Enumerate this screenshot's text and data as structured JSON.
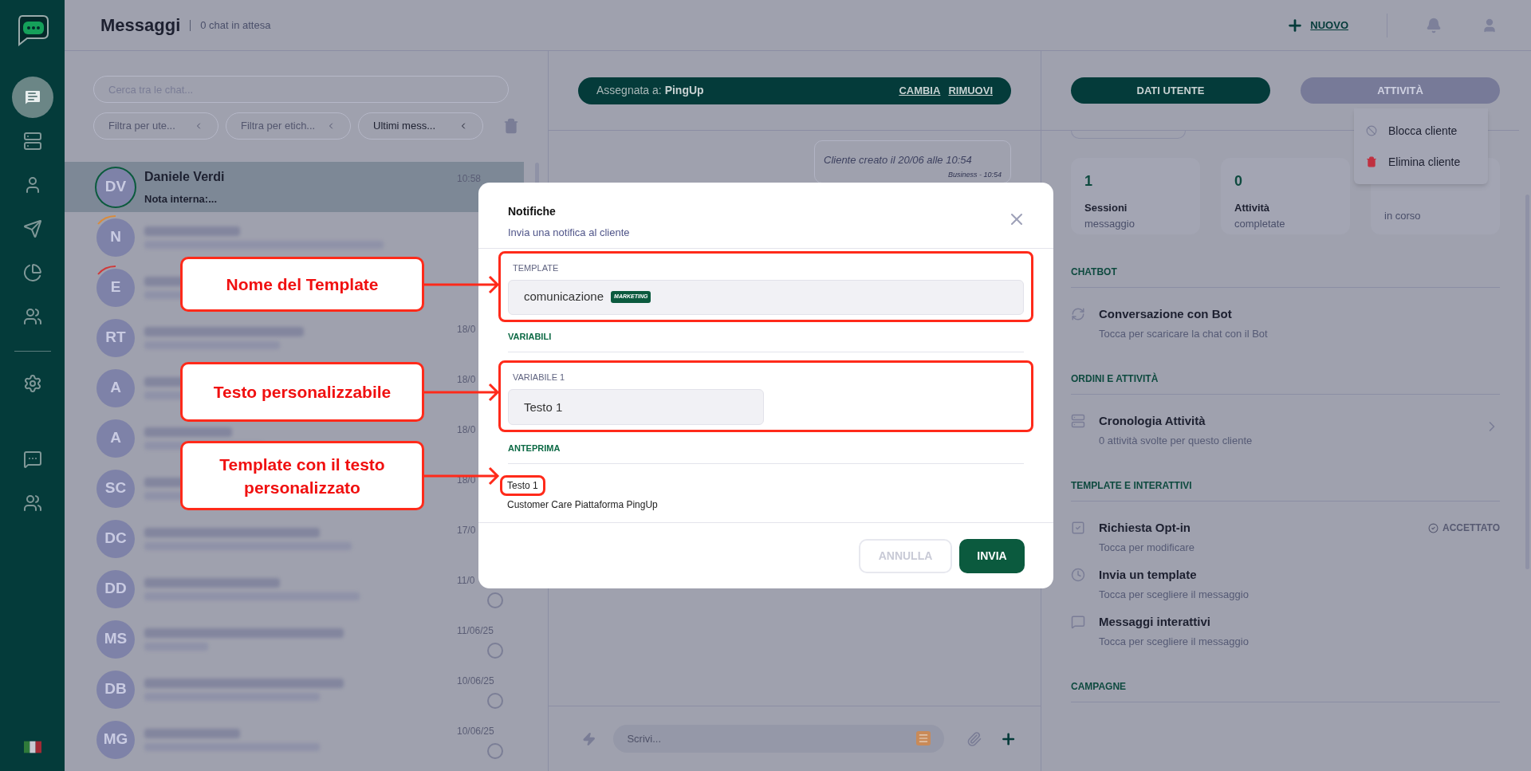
{
  "nav": [
    {
      "selected": true
    },
    {
      "selected": false
    },
    {
      "selected": false
    },
    {
      "selected": false
    },
    {
      "selected": false
    },
    {
      "selected": false
    },
    {
      "selected": false
    },
    {
      "selected": false
    },
    {
      "selected": false
    }
  ],
  "header": {
    "title": "Messaggi",
    "subtitle": "0 chat in attesa",
    "new_button": "NUOVO"
  },
  "chat_list": {
    "search": {
      "placeholder": "Cerca tra le chat..."
    },
    "filters": [
      {
        "label": "Filtra per ute...",
        "active": false
      },
      {
        "label": "Filtra per etich...",
        "active": false
      },
      {
        "label": "Ultimi mess...",
        "active": true
      }
    ],
    "chats": [
      {
        "initials": "DV",
        "name": "Daniele Verdi",
        "preview": "Nota interna:...",
        "time": "10:58",
        "color": "#0b5a3e",
        "selected": true,
        "circle": false
      },
      {
        "initials": "N",
        "color": "#d98b3c",
        "selected": false,
        "circle": false
      },
      {
        "initials": "E",
        "color": "#d03a3a",
        "selected": false,
        "circle": false
      },
      {
        "initials": "RT",
        "time": "18/0",
        "selected": false,
        "circle": false
      },
      {
        "initials": "A",
        "time": "18/0",
        "selected": false,
        "circle": false
      },
      {
        "initials": "A",
        "time": "18/0",
        "selected": false,
        "circle": false
      },
      {
        "initials": "SC",
        "time": "18/0",
        "selected": false,
        "circle": false
      },
      {
        "initials": "DC",
        "time": "17/0",
        "selected": false,
        "circle": false
      },
      {
        "initials": "DD",
        "time": "11/0",
        "selected": false,
        "circle": true
      },
      {
        "initials": "MS",
        "time": "11/06/25",
        "selected": false,
        "circle": true
      },
      {
        "initials": "DB",
        "time": "10/06/25",
        "selected": false,
        "circle": true
      },
      {
        "initials": "MG",
        "time": "10/06/25",
        "selected": false,
        "circle": true
      }
    ]
  },
  "conversation": {
    "assignment": {
      "label": "Assegnata a:",
      "value": "PingUp",
      "actions": [
        "CAMBIA",
        "RIMUOVI"
      ]
    },
    "messages": [
      {
        "text": "Cliente creato il 20/06 alle 10:54",
        "meta": "Business - 10:54"
      }
    ],
    "composer": {
      "placeholder": "Scrivi..."
    }
  },
  "details": {
    "tabs": [
      {
        "label": "DATI UTENTE",
        "selected": true
      },
      {
        "label": "ATTIVITÀ",
        "selected": false
      }
    ],
    "stats": [
      {
        "value": "1",
        "label": "Sessioni",
        "sublabel": "messaggio"
      },
      {
        "value": "0",
        "label": "Attività",
        "sublabel": "completate"
      },
      {
        "sublabel": "in corso"
      }
    ],
    "menu": [
      {
        "label": "Blocca cliente",
        "kind": "block"
      },
      {
        "label": "Elimina cliente",
        "kind": "delete"
      }
    ],
    "sections": [
      {
        "title": "CHATBOT",
        "items": [
          {
            "title": "Conversazione con Bot",
            "subtitle": "Tocca per scaricare la chat con il Bot",
            "chevron": false
          }
        ]
      },
      {
        "title": "ORDINI E ATTIVITÀ",
        "items": [
          {
            "title": "Cronologia Attività",
            "subtitle": "0 attività svolte per questo cliente",
            "chevron": true
          }
        ]
      },
      {
        "title": "TEMPLATE E INTERATTIVI",
        "items": [
          {
            "title": "Richiesta Opt-in",
            "subtitle": "Tocca per modificare",
            "status": "ACCETTATO",
            "chevron": false
          },
          {
            "title": "Invia un template",
            "subtitle": "Tocca per scegliere il messaggio",
            "chevron": false
          },
          {
            "title": "Messaggi interattivi",
            "subtitle": "Tocca per scegliere il messaggio",
            "chevron": false
          }
        ]
      },
      {
        "title": "CAMPAGNE"
      }
    ]
  },
  "modal": {
    "title": "Notifiche",
    "subtitle": "Invia una notifica al cliente",
    "template": {
      "label": "TEMPLATE",
      "value": "comunicazione",
      "badge": "MARKETING"
    },
    "variables_title": "VARIABILI",
    "variables": [
      {
        "label": "VARIABILE 1",
        "value": "Testo 1"
      }
    ],
    "preview_title": "ANTEPRIMA",
    "preview": [
      "Testo 1",
      "Customer Care Piattaforma PingUp"
    ],
    "buttons": [
      {
        "label": "ANNULLA",
        "kind": "secondary"
      },
      {
        "label": "INVIA",
        "kind": "primary"
      }
    ]
  },
  "annotations": [
    {
      "text": "Nome del Template"
    },
    {
      "text": "Testo personalizzabile"
    },
    {
      "text": "Template con il testo personalizzato"
    }
  ]
}
